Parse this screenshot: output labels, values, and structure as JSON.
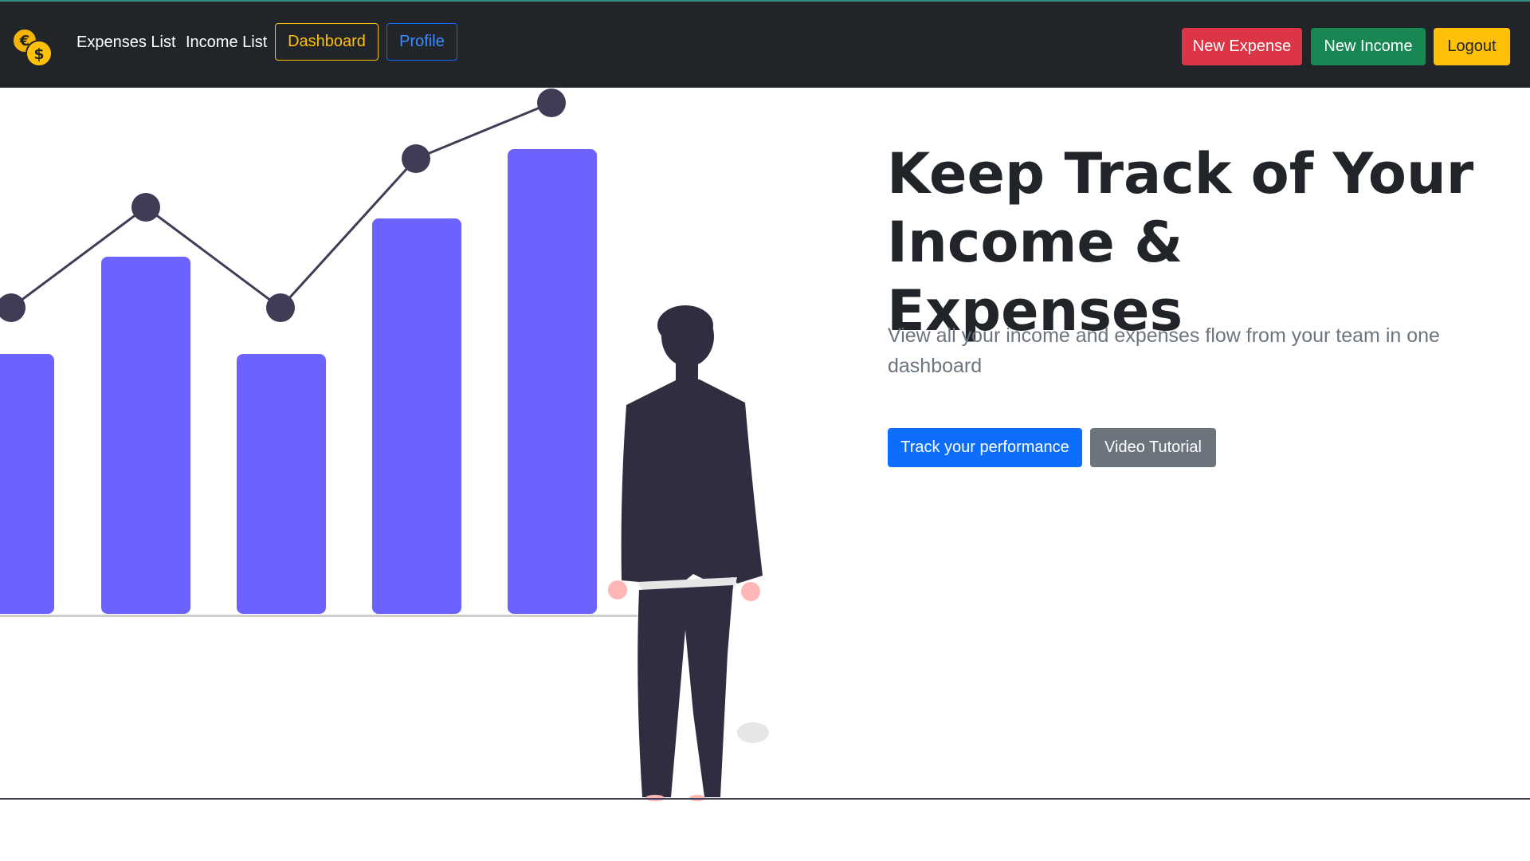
{
  "navbar": {
    "logo_icon": "coins-euro-dollar-icon",
    "links": [
      {
        "label": "Expenses List"
      },
      {
        "label": "Income List"
      }
    ],
    "dashboard_label": "Dashboard",
    "profile_label": "Profile",
    "new_expense_label": "New Expense",
    "new_income_label": "New Income",
    "logout_label": "Logout"
  },
  "hero": {
    "title_line1": "Keep Track of Your",
    "title_line2": "Income & Expenses",
    "subtitle": "View all your income and expenses flow from your team in one dashboard",
    "track_button_label": "Track your performance",
    "video_button_label": "Video Tutorial"
  },
  "colors": {
    "navbar_bg": "#212529",
    "bar_color": "#6c63ff",
    "line_color": "#3f3d56",
    "danger": "#dc3545",
    "success": "#198754",
    "warning": "#ffc107",
    "primary": "#0d6efd",
    "secondary": "#6c757d"
  }
}
